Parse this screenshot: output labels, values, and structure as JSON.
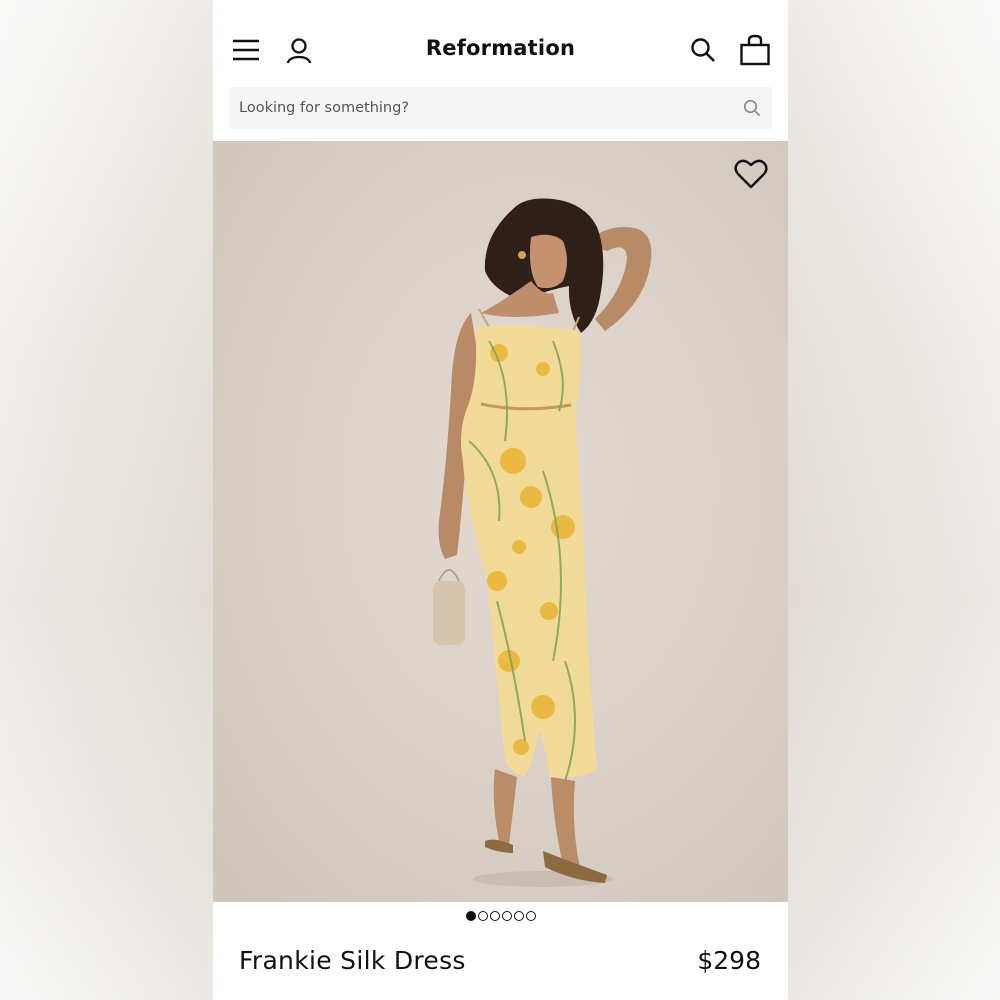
{
  "header": {
    "brand": "Reformation",
    "icons": {
      "menu": "hamburger-menu-icon",
      "account": "user-icon",
      "search": "search-icon",
      "bag": "shopping-bag-icon"
    }
  },
  "search": {
    "placeholder": "Looking for something?",
    "value": ""
  },
  "product": {
    "image_alt": "Model wearing yellow floral slip midi dress",
    "wishlist_icon": "heart-icon",
    "carousel": {
      "total": 6,
      "active": 1
    },
    "name": "Frankie Silk Dress",
    "price": "$298"
  },
  "colors": {
    "text": "#111111",
    "search_bg": "#f5f5f5",
    "image_bg": "#d8cfc6",
    "dress": "#f3dc9a"
  }
}
